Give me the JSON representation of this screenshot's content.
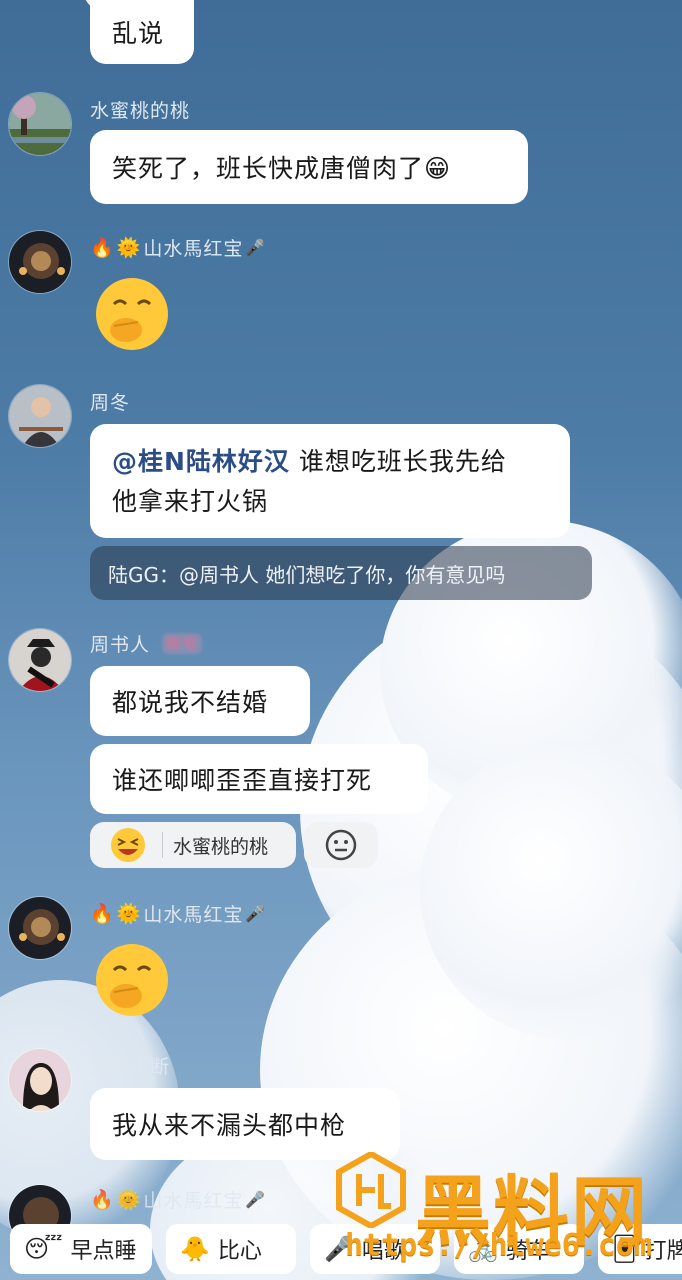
{
  "messages": {
    "top_partial_text": "乱说",
    "m1": {
      "user": "水蜜桃的桃",
      "text": "笑死了，班长快成唐僧肉了😁"
    },
    "m2": {
      "user": "山水馬红宝"
    },
    "m3": {
      "user": "周冬",
      "mention": "@桂N陆林好汉",
      "text_line1": " 谁想吃班长我先给",
      "text_line2": "他拿来打火锅",
      "quote": "陆GG：@周书人 她们想吃了你，你有意见吗"
    },
    "m4": {
      "user": "周书人",
      "badge": "称号",
      "text1": "都说我不结婚",
      "text2": "谁还唧唧歪歪直接打死",
      "reaction_user": "水蜜桃的桃"
    },
    "m5": {
      "user": "山水馬红宝"
    },
    "m6": {
      "user": "源源不断",
      "text": "我从来不漏头都中枪"
    },
    "m7": {
      "user": "山水馬红宝"
    }
  },
  "quick_replies": [
    "早点睡",
    "比心",
    "唱歌",
    "骑车",
    "打牌"
  ],
  "watermark": {
    "title": "黑料网",
    "url": "https://hlwe6.com"
  },
  "colors": {
    "accent": "#f4a21c",
    "mention": "#2a4d87"
  }
}
